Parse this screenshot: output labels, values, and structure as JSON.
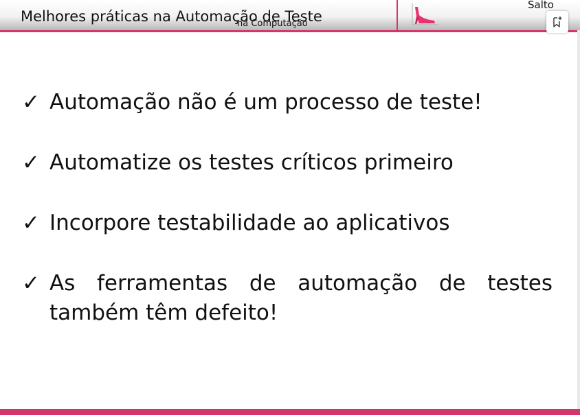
{
  "header": {
    "title": "Melhores práticas na Automação de Teste",
    "subtitle": "na Computação",
    "logo_text": "Salto",
    "logo_icon": "high-heel-shoe-icon",
    "bookmark_icon": "bookmark-add-icon"
  },
  "colors": {
    "accent": "#d6336c",
    "text": "#111111"
  },
  "bullets": [
    {
      "check": "✓",
      "text": "Automação não é um processo de teste!"
    },
    {
      "check": "✓",
      "text": "Automatize os testes críticos primeiro"
    },
    {
      "check": "✓",
      "text": "Incorpore testabilidade ao aplicativos"
    },
    {
      "check": "✓",
      "text": "As ferramentas de automação de testes também têm defeito!"
    }
  ]
}
